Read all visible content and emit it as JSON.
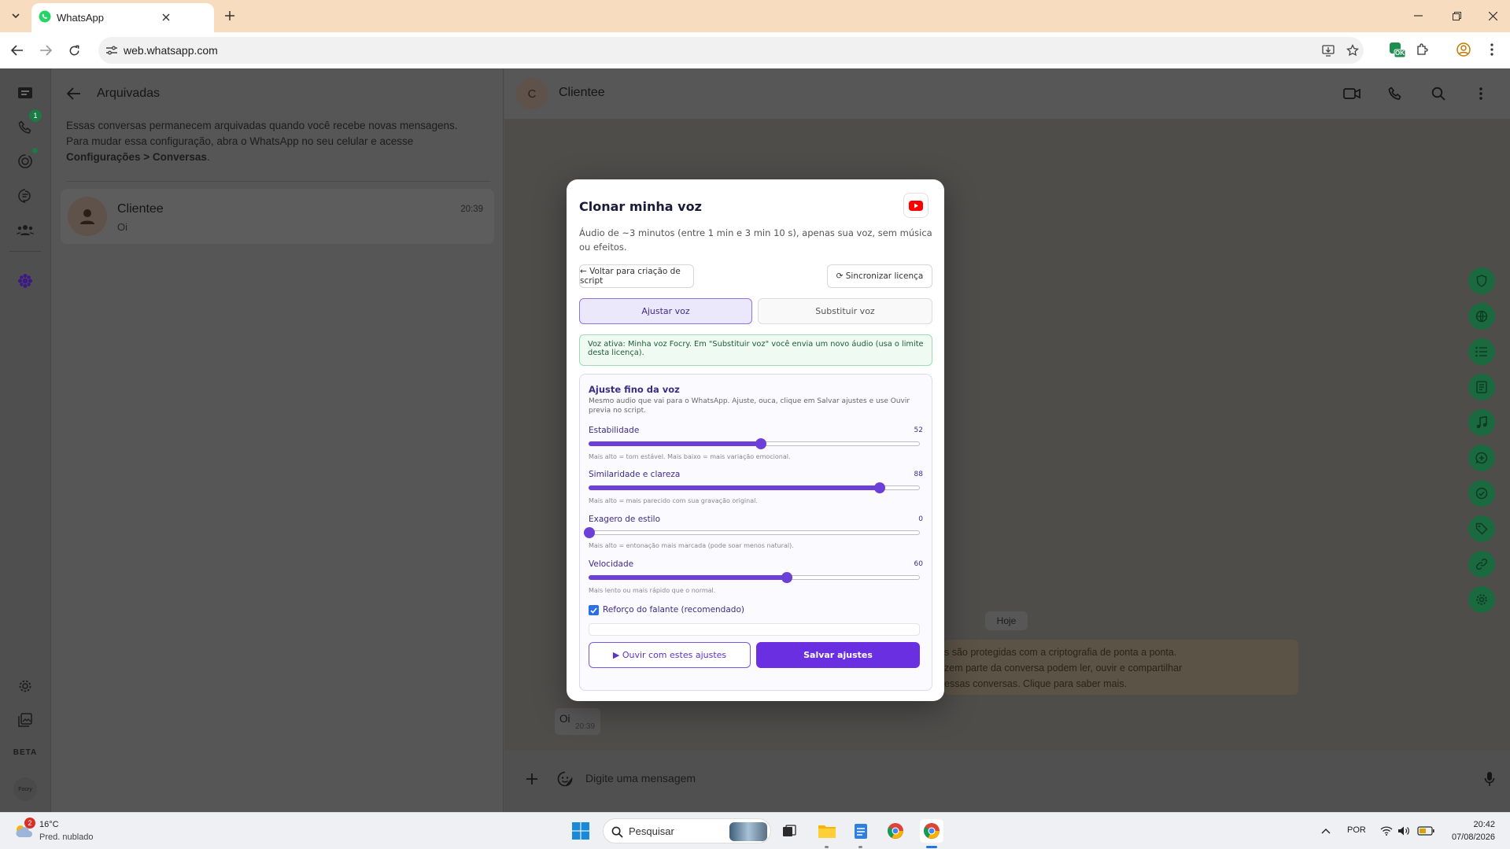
{
  "browser": {
    "tab_title": "WhatsApp",
    "url": "web.whatsapp.com",
    "extension_badge": "OK"
  },
  "rail": {
    "calls_badge": "1",
    "beta_label": "BETA",
    "profile_label": "Focry"
  },
  "archived": {
    "title": "Arquivadas",
    "notice_line1": "Essas conversas permanecem arquivadas quando você recebe novas mensagens.",
    "notice_line2": "Para mudar essa configuração, abra o WhatsApp no seu celular e acesse",
    "notice_bold": "Configurações > Conversas",
    "notice_end": ".",
    "chat": {
      "name": "Clientee",
      "preview": "Oi",
      "time": "20:39"
    }
  },
  "chat": {
    "avatar_letter": "C",
    "name": "Clientee",
    "day_label": "Hoje",
    "encryption_line1": "s são protegidas com a criptografia de ponta a ponta.",
    "encryption_line2": "zem parte da conversa podem ler, ouvir e compartilhar",
    "encryption_line3": "essas conversas. Clique para saber mais.",
    "message_text": "Oi",
    "message_time": "20:39",
    "composer_placeholder": "Digite uma mensagem"
  },
  "modal": {
    "title": "Clonar minha voz",
    "subtitle": "Áudio de ~3 minutos (entre 1 min e 3 min 10 s), apenas sua voz, sem música ou efeitos.",
    "back_button": "← Voltar para criação de script",
    "sync_button": "⟳ Sincronizar licença",
    "tab_adjust": "Ajustar voz",
    "tab_replace": "Substituir voz",
    "info_text": "Voz ativa: Minha voz Focry. Em \"Substituir voz\" você envia um novo áudio (usa o limite desta licença).",
    "panel_title": "Ajuste fino da voz",
    "panel_desc": "Mesmo audio que vai para o WhatsApp. Ajuste, ouca, clique em Salvar ajustes e use Ouvir previa no script.",
    "sliders": [
      {
        "label": "Estabilidade",
        "value": 52,
        "max": 100,
        "hint": "Mais alto = tom estável. Mais baixo = mais variação emocional."
      },
      {
        "label": "Similaridade e clareza",
        "value": 88,
        "max": 100,
        "hint": "Mais alto = mais parecido com sua gravação original."
      },
      {
        "label": "Exagero de estilo",
        "value": 0,
        "max": 100,
        "hint": "Mais alto = entonação mais marcada (pode soar menos natural)."
      },
      {
        "label": "Velocidade",
        "value": 60,
        "max": 100,
        "hint": "Mais lento ou mais rápido que o normal."
      }
    ],
    "speaker_boost_label": "Reforço do falante (recomendado)",
    "speaker_boost_checked": true,
    "listen_button": "▶ Ouvir com estes ajustes",
    "save_button": "Salvar ajustes"
  },
  "taskbar": {
    "weather_badge": "2",
    "weather_temp": "16°C",
    "weather_desc": "Pred. nublado",
    "search_placeholder": "Pesquisar",
    "language": "POR",
    "time": "20:42",
    "date": "07/08/2026"
  },
  "colors": {
    "accent_purple": "#6a2fe0",
    "whatsapp_green": "#1b6a3f",
    "chrome_tab_bar": "#f7dcc0"
  }
}
